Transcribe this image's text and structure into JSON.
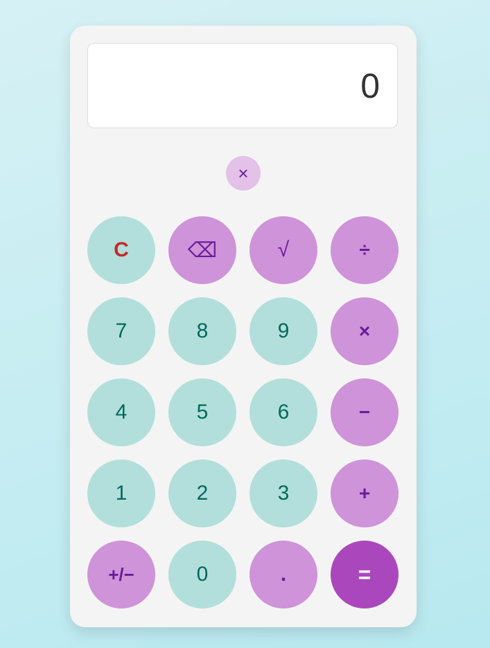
{
  "display": {
    "value": "0"
  },
  "history_close": {
    "label": "×"
  },
  "keys": {
    "clear": "C",
    "backspace": "⌫",
    "sqrt": "√",
    "divide": "÷",
    "seven": "7",
    "eight": "8",
    "nine": "9",
    "multiply": "×",
    "four": "4",
    "five": "5",
    "six": "6",
    "subtract": "−",
    "one": "1",
    "two": "2",
    "three": "3",
    "add": "+",
    "negate": "+/−",
    "zero": "0",
    "decimal": ".",
    "equals": "="
  },
  "colors": {
    "number_key_bg": "#b2dfdb",
    "number_key_text": "#00695c",
    "operator_key_bg": "#ce93d8",
    "operator_key_text": "#6a1b9a",
    "clear_text": "#c62828",
    "equals_bg": "#ab47bc",
    "equals_text": "#ffffff",
    "history_close_bg": "#e3c1e9"
  }
}
